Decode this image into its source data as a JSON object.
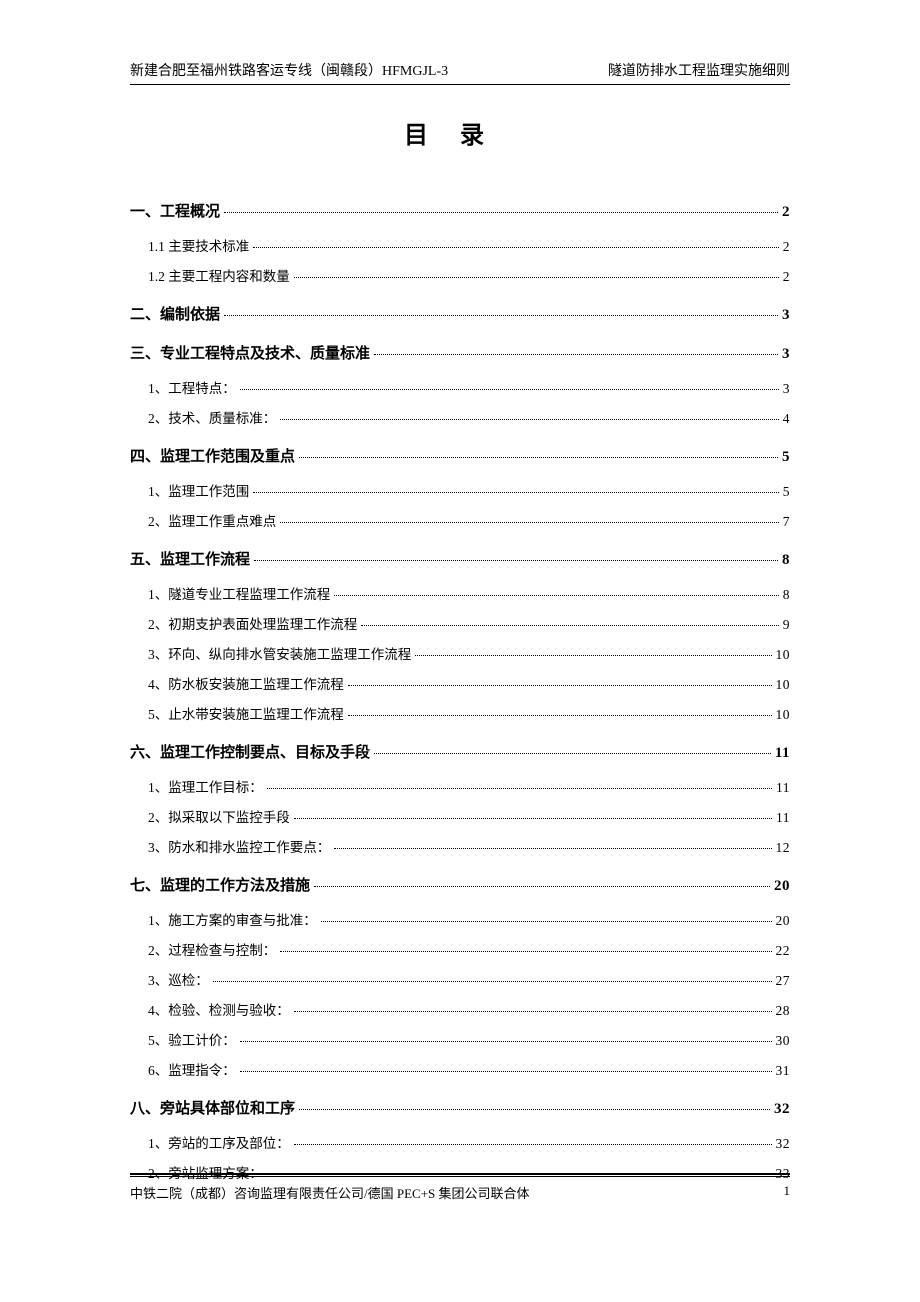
{
  "header": {
    "left": "新建合肥至福州铁路客运专线（闽赣段）HFMGJL-3",
    "right": "隧道防排水工程监理实施细则"
  },
  "title": "目录",
  "toc": [
    {
      "level": 1,
      "label": "一、工程概况",
      "page": "2"
    },
    {
      "level": 2,
      "label": "1.1 主要技术标准",
      "page": "2"
    },
    {
      "level": 2,
      "label": "1.2 主要工程内容和数量",
      "page": "2"
    },
    {
      "level": 1,
      "label": "二、编制依据",
      "page": "3"
    },
    {
      "level": 1,
      "label": "三、专业工程特点及技术、质量标准",
      "page": "3"
    },
    {
      "level": 2,
      "label": "1、工程特点：",
      "page": "3"
    },
    {
      "level": 2,
      "label": "2、技术、质量标准：",
      "page": "4"
    },
    {
      "level": 1,
      "label": "四、监理工作范围及重点",
      "page": "5"
    },
    {
      "level": 2,
      "label": "1、监理工作范围",
      "page": "5"
    },
    {
      "level": 2,
      "label": "2、监理工作重点难点",
      "page": "7"
    },
    {
      "level": 1,
      "label": "五、监理工作流程",
      "page": "8"
    },
    {
      "level": 2,
      "label": "1、隧道专业工程监理工作流程",
      "page": "8"
    },
    {
      "level": 2,
      "label": "2、初期支护表面处理监理工作流程",
      "page": "9"
    },
    {
      "level": 2,
      "label": "3、环向、纵向排水管安装施工监理工作流程",
      "page": "10"
    },
    {
      "level": 2,
      "label": "4、防水板安装施工监理工作流程",
      "page": "10"
    },
    {
      "level": 2,
      "label": "5、止水带安装施工监理工作流程",
      "page": "10"
    },
    {
      "level": 1,
      "label": "六、监理工作控制要点、目标及手段",
      "page": "11"
    },
    {
      "level": 2,
      "label": "1、监理工作目标：",
      "page": "11"
    },
    {
      "level": 2,
      "label": "2、拟采取以下监控手段",
      "page": "11"
    },
    {
      "level": 2,
      "label": "3、防水和排水监控工作要点：",
      "page": "12"
    },
    {
      "level": 1,
      "label": "七、监理的工作方法及措施",
      "page": "20"
    },
    {
      "level": 2,
      "label": "1、施工方案的审查与批准：",
      "page": "20"
    },
    {
      "level": 2,
      "label": "2、过程检查与控制：",
      "page": "22"
    },
    {
      "level": 2,
      "label": "3、巡检：",
      "page": "27"
    },
    {
      "level": 2,
      "label": "4、检验、检测与验收：",
      "page": "28"
    },
    {
      "level": 2,
      "label": "5、验工计价：",
      "page": "30"
    },
    {
      "level": 2,
      "label": "6、监理指令：",
      "page": "31"
    },
    {
      "level": 1,
      "label": "八、旁站具体部位和工序",
      "page": "32"
    },
    {
      "level": 2,
      "label": "1、旁站的工序及部位：",
      "page": "32"
    },
    {
      "level": 2,
      "label": "2、旁站监理方案：",
      "page": "33"
    }
  ],
  "footer": {
    "left": "中铁二院（成都）咨询监理有限责任公司/德国 PEC+S 集团公司联合体",
    "right": "1"
  }
}
